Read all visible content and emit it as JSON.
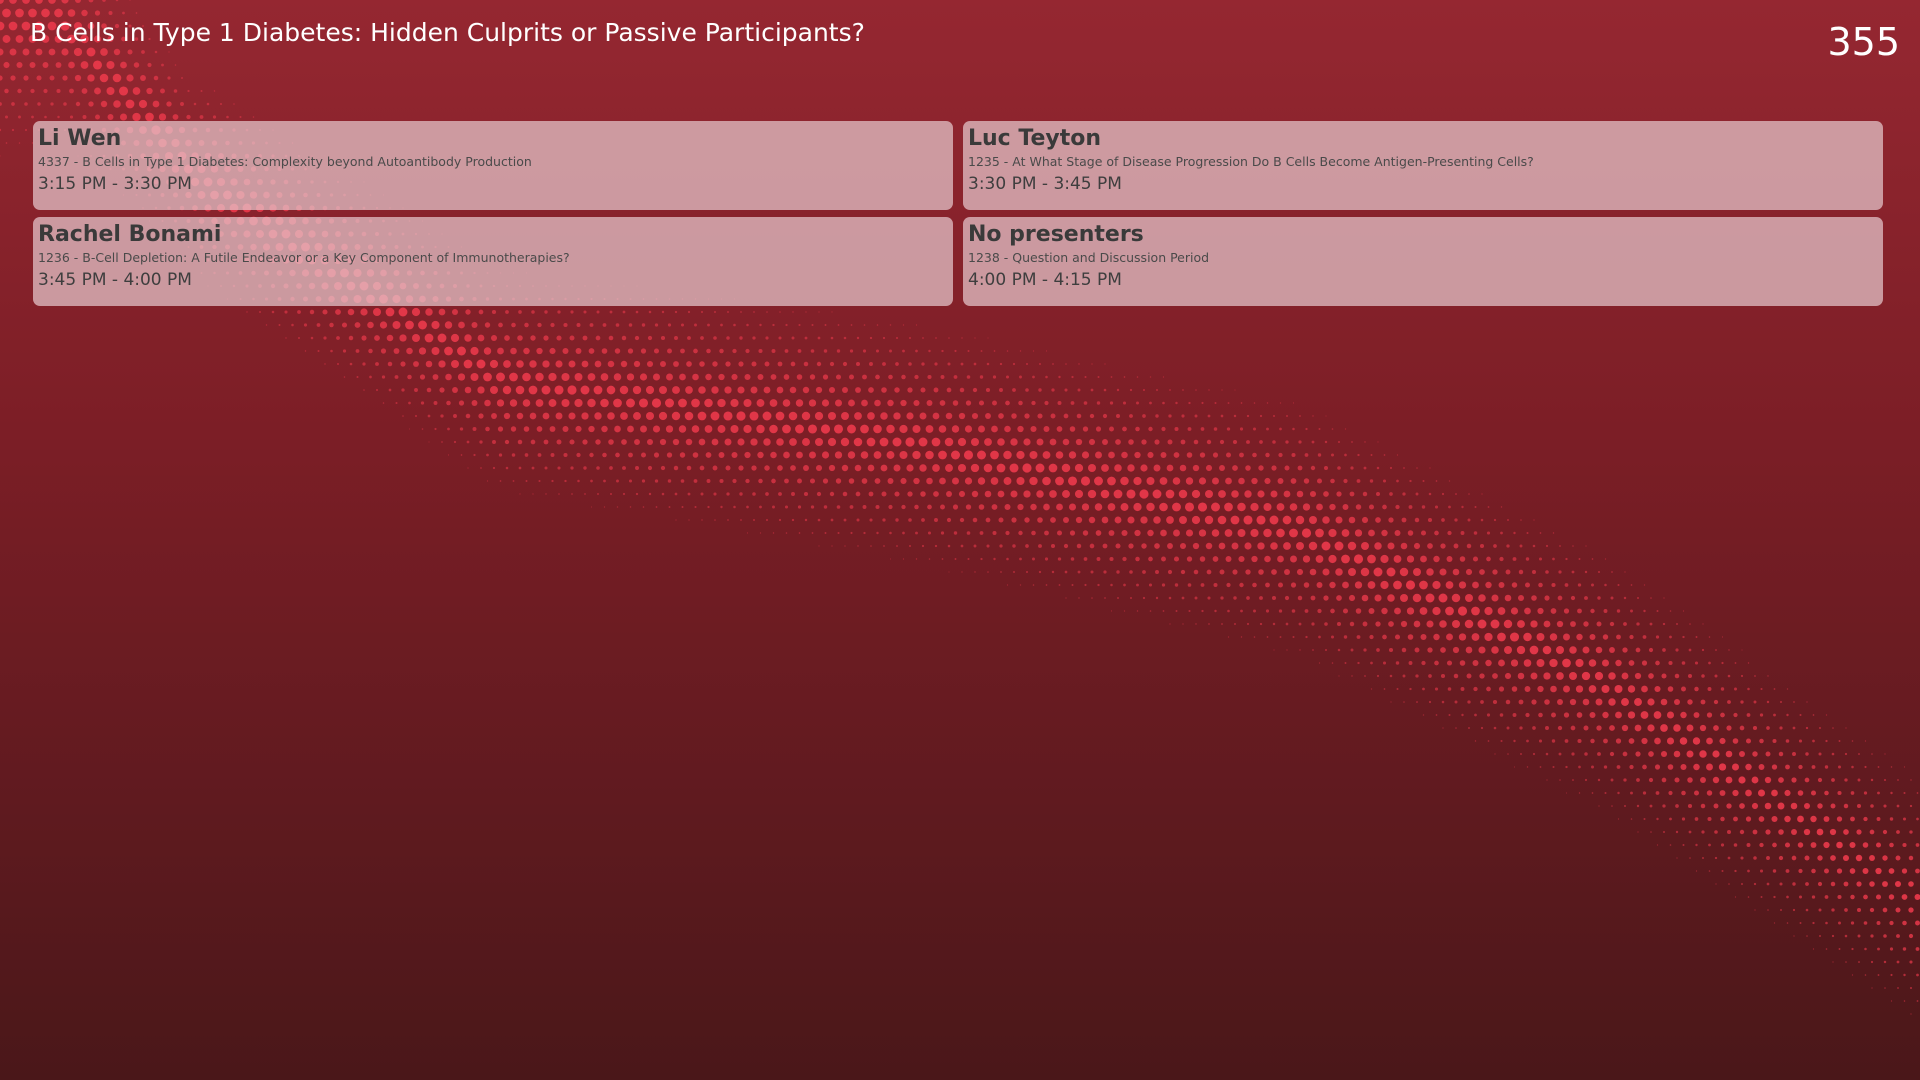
{
  "header": {
    "session_title": "B Cells in Type 1 Diabetes: Hidden Culprits or Passive Participants?",
    "room_number": "355"
  },
  "presentations": [
    {
      "presenter": "Li Wen",
      "abstract": "4337 - B Cells in Type 1 Diabetes: Complexity beyond Autoantibody Production",
      "time": "3:15 PM - 3:30 PM"
    },
    {
      "presenter": "Luc Teyton",
      "abstract": "1235 - At What Stage of Disease Progression Do B Cells Become Antigen-Presenting Cells?",
      "time": "3:30 PM - 3:45 PM"
    },
    {
      "presenter": "Rachel Bonami",
      "abstract": "1236 - B-Cell Depletion: A Futile Endeavor or a Key Component of Immunotherapies?",
      "time": "3:45 PM - 4:00 PM"
    },
    {
      "presenter": "No presenters",
      "abstract": "1238 - Question and Discussion Period",
      "time": "4:00 PM - 4:15 PM"
    }
  ],
  "colors": {
    "background_top": "#952731",
    "background_bottom": "#4a1719",
    "dot_color": "#e8384a",
    "card_fill": "#e6c8cd"
  },
  "decoration": "halftone-dot-wave-background"
}
